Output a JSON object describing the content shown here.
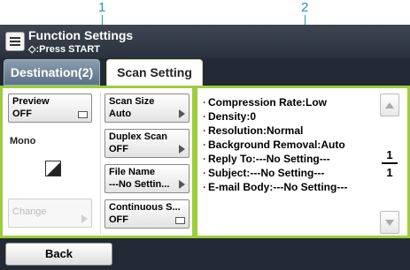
{
  "callouts": [
    "1",
    "2"
  ],
  "header": {
    "title": "Function Settings",
    "subtitle": "◇:Press START"
  },
  "tabs": [
    {
      "label": "Destination(2)",
      "active": false
    },
    {
      "label": "Scan Setting",
      "active": true
    }
  ],
  "left": {
    "preview": {
      "label": "Preview",
      "value": "OFF"
    },
    "mode_text": "Mono",
    "change_label": "Change",
    "settings": [
      {
        "label": "Scan Size",
        "value": "Auto"
      },
      {
        "label": "Duplex Scan",
        "value": "OFF"
      },
      {
        "label": "File Name",
        "value": "---No Settin..."
      },
      {
        "label": "Continuous S...",
        "value": "OFF"
      }
    ]
  },
  "info": [
    "Compression Rate:Low",
    "Density:0",
    "Resolution:Normal",
    "Background Removal:Auto",
    "Reply To:---No Setting---",
    "Subject:---No Setting---",
    "E-mail Body:---No Setting---"
  ],
  "pager": {
    "current": "1",
    "total": "1"
  },
  "footer": {
    "back_label": "Back"
  },
  "colors": {
    "accent_green": "#9ccd3a",
    "callout_blue": "#1b9ab5",
    "screen_dark": "#232a35"
  },
  "icons": {
    "title": "menu-list-icon",
    "mode": "mono-color-icon"
  }
}
